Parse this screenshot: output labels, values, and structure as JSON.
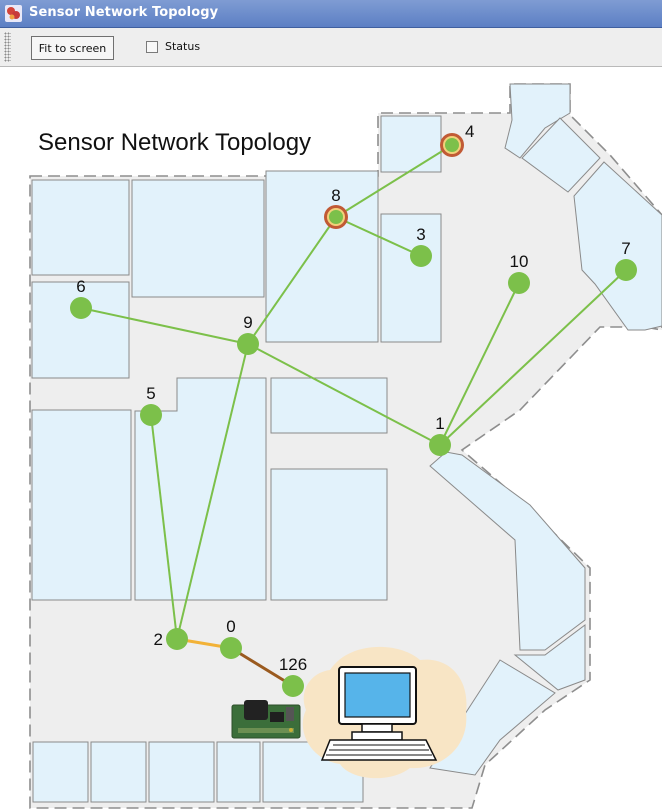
{
  "window": {
    "title": "Sensor Network Topology"
  },
  "toolbar": {
    "fit_label": "Fit to screen",
    "status_label": "Status",
    "status_checked": false
  },
  "map": {
    "heading": "Sensor Network Topology",
    "nodes": [
      {
        "id": "4",
        "label": "4",
        "highlighted": true
      },
      {
        "id": "8",
        "label": "8",
        "highlighted": true
      },
      {
        "id": "3",
        "label": "3",
        "highlighted": false
      },
      {
        "id": "10",
        "label": "10",
        "highlighted": false
      },
      {
        "id": "7",
        "label": "7",
        "highlighted": false
      },
      {
        "id": "6",
        "label": "6",
        "highlighted": false
      },
      {
        "id": "9",
        "label": "9",
        "highlighted": false
      },
      {
        "id": "5",
        "label": "5",
        "highlighted": false
      },
      {
        "id": "1",
        "label": "1",
        "highlighted": false
      },
      {
        "id": "2",
        "label": "2",
        "highlighted": false
      },
      {
        "id": "0",
        "label": "0",
        "highlighted": false
      },
      {
        "id": "126",
        "label": "126",
        "highlighted": false
      }
    ],
    "links": [
      {
        "from": "4",
        "to": "8",
        "color": "#7cc04a"
      },
      {
        "from": "8",
        "to": "3",
        "color": "#7cc04a"
      },
      {
        "from": "8",
        "to": "9",
        "color": "#7cc04a"
      },
      {
        "from": "6",
        "to": "9",
        "color": "#7cc04a"
      },
      {
        "from": "9",
        "to": "1",
        "color": "#7cc04a"
      },
      {
        "from": "9",
        "to": "2",
        "color": "#7cc04a"
      },
      {
        "from": "5",
        "to": "2",
        "color": "#7cc04a"
      },
      {
        "from": "10",
        "to": "1",
        "color": "#7cc04a"
      },
      {
        "from": "7",
        "to": "1",
        "color": "#7cc04a"
      },
      {
        "from": "2",
        "to": "0",
        "color": "#f2b237"
      },
      {
        "from": "0",
        "to": "126",
        "color": "#9a5a1f"
      }
    ]
  },
  "colors": {
    "node_fill": "#7cc04a",
    "highlight_ring": "#c15a35",
    "room_fill": "#e2f2fb",
    "floor_fill": "#eeeeee"
  },
  "icons": [
    "app-icon",
    "sensor-board-icon",
    "base-station-computer-icon"
  ]
}
